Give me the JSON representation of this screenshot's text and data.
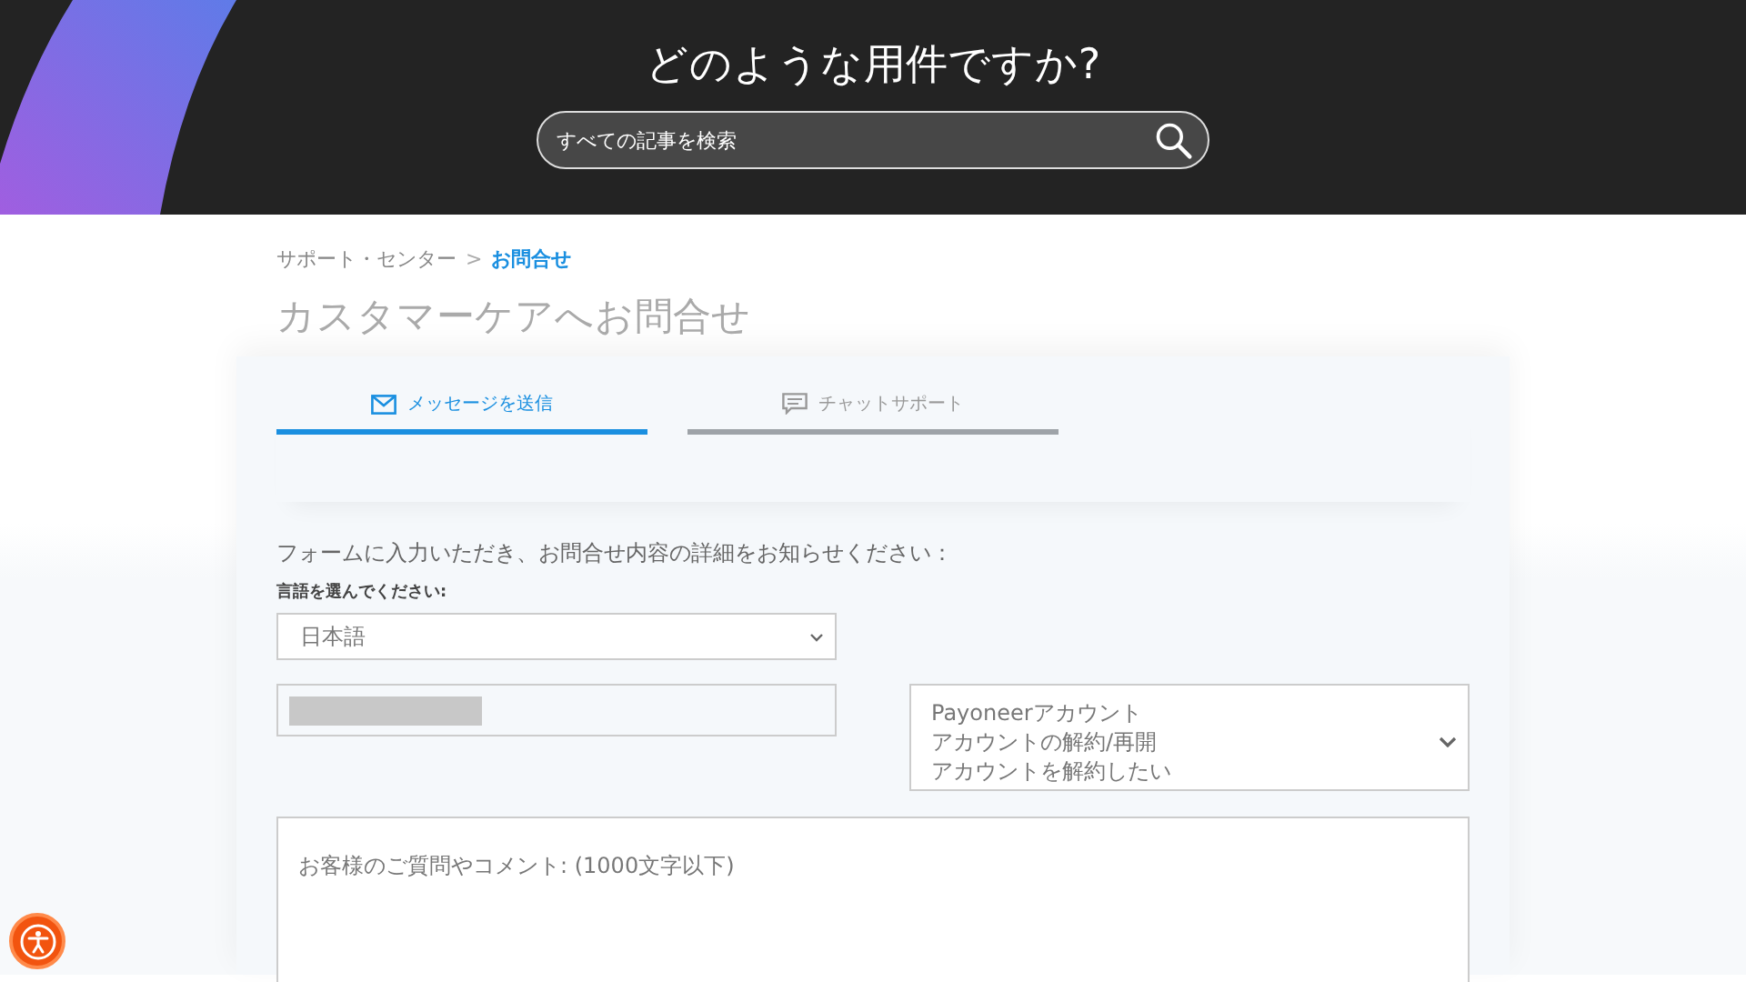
{
  "header": {
    "title": "どのような用件ですか?",
    "search": {
      "placeholder": "すべての記事を検索"
    }
  },
  "breadcrumb": [
    {
      "label": "サポート・センター",
      "current": false
    },
    {
      "label": "お問合せ",
      "current": true
    }
  ],
  "breadcrumb_separator": ">",
  "page_title": "カスタマーケアへお問合せ",
  "tabs": [
    {
      "label": "メッセージを送信",
      "kind": "mail",
      "selected": true
    },
    {
      "label": "チャットサポート",
      "kind": "chat",
      "selected": false
    }
  ],
  "form": {
    "intro": "フォームに入力いただき、お問合せ内容の詳細をお知らせください：",
    "language_label": "言語を選んでください:",
    "language": {
      "value": "日本語"
    },
    "redacted_field": {
      "redacted": true
    },
    "topic": {
      "lines": [
        "Payoneerアカウント",
        "アカウントの解約/再開",
        "アカウントを解約したい"
      ]
    },
    "comment": {
      "placeholder": "お客様のご質問やコメント: (1000文字以下)"
    }
  }
}
